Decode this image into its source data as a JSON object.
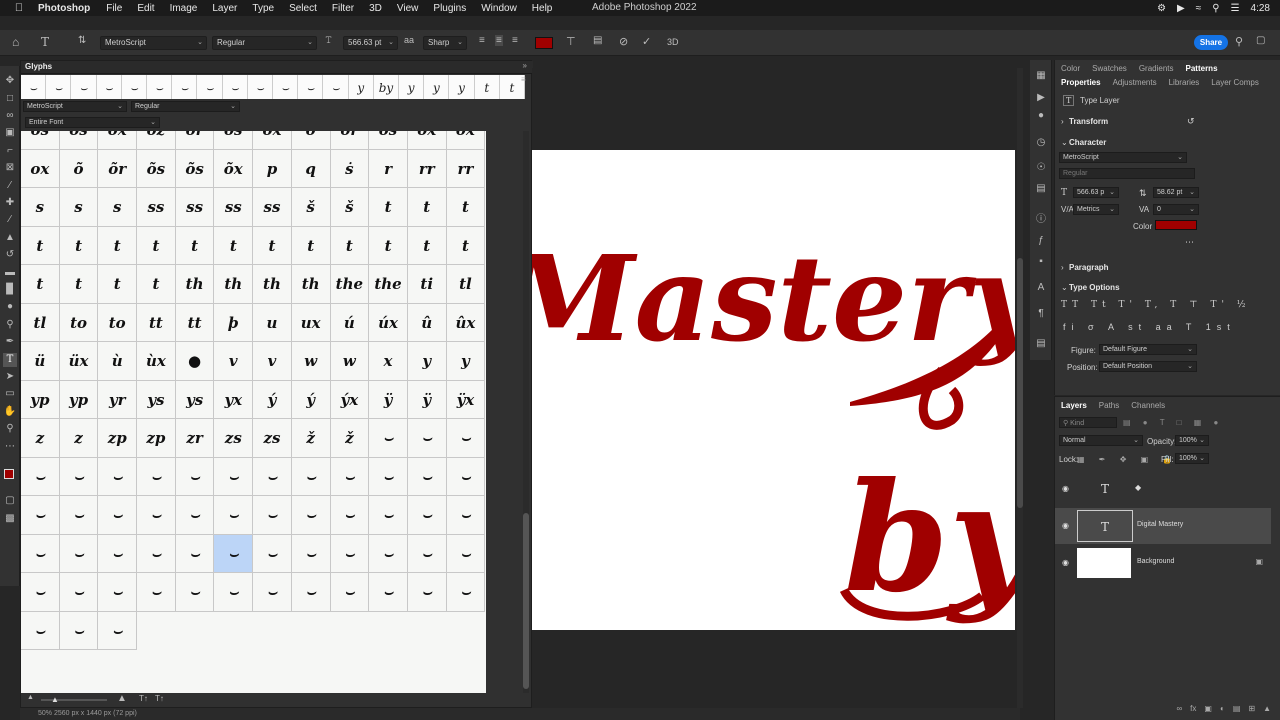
{
  "menubar": {
    "app_name": "Photoshop",
    "items": [
      "File",
      "Edit",
      "Image",
      "Layer",
      "Type",
      "Select",
      "Filter",
      "3D",
      "View",
      "Plugins",
      "Window",
      "Help"
    ],
    "window_title": "Adobe Photoshop 2022",
    "clock": "4:28"
  },
  "options_bar": {
    "font_family": "MetroScript",
    "font_style": "Regular",
    "font_size": "566.63 pt",
    "antialias": "Sharp",
    "text_color": "#a00000",
    "mode_3d": "3D",
    "share_label": "Share"
  },
  "glyphs_panel": {
    "title": "Glyphs",
    "font_family": "MetroScript",
    "font_style": "Regular",
    "show": "Entire Font",
    "recent": [
      "⌣",
      "⌣",
      "⌣",
      "⌣",
      "⌣",
      "⌣",
      "⌣",
      "⌣",
      "⌣",
      "⌣",
      "⌣",
      "⌣",
      "⌣",
      "y",
      "by",
      "y",
      "y",
      "y",
      "t",
      "t"
    ],
    "cells": [
      "os",
      "os",
      "ox",
      "oz",
      "or",
      "os",
      "ox",
      "o",
      "or",
      "os",
      "ox",
      "ox",
      "ox",
      "õ",
      "õr",
      "õs",
      "õs",
      "õx",
      "p",
      "q",
      "ṡ",
      "r",
      "rr",
      "rr",
      "s",
      "s",
      "s",
      "ss",
      "ss",
      "ss",
      "ss",
      "š",
      "š",
      "t",
      "t",
      "t",
      "t",
      "t",
      "t",
      "t",
      "t",
      "t",
      "t",
      "t",
      "t",
      "t",
      "t",
      "t",
      "t",
      "t",
      "t",
      "t",
      "th",
      "th",
      "th",
      "th",
      "the",
      "the",
      "ti",
      "tl",
      "tl",
      "to",
      "to",
      "tt",
      "tt",
      "þ",
      "u",
      "ux",
      "ú",
      "úx",
      "û",
      "ûx",
      "ü",
      "üx",
      "ù",
      "ùx",
      "●",
      "v",
      "v",
      "w",
      "w",
      "x",
      "y",
      "y",
      "yp",
      "yp",
      "yr",
      "ys",
      "ys",
      "yx",
      "ý",
      "ý",
      "ýx",
      "ÿ",
      "ÿ",
      "ÿx",
      "z",
      "z",
      "zp",
      "zp",
      "zr",
      "zs",
      "zs",
      "ž",
      "ž",
      "⌣",
      "⌣",
      "⌣",
      "⌣",
      "⌣",
      "⌣",
      "⌣",
      "⌣",
      "⌣",
      "⌣",
      "⌣",
      "⌣",
      "⌣",
      "⌣",
      "⌣",
      "⌣",
      "⌣",
      "⌣",
      "⌣",
      "⌣",
      "⌣",
      "⌣",
      "⌣",
      "⌣",
      "⌣",
      "⌣",
      "⌣",
      "⌣",
      "⌣",
      "⌣",
      "⌣",
      "⌣",
      "⌣",
      "⌣",
      "⌣",
      "⌣",
      "⌣",
      "⌣",
      "⌣",
      "⌣",
      "⌣",
      "⌣",
      "⌣",
      "⌣",
      "⌣",
      "⌣",
      "⌣",
      "⌣",
      "⌣",
      "⌣",
      "⌣",
      "⌣",
      "⌣",
      "⌣"
    ],
    "selected_index": 137
  },
  "canvas": {
    "line1": "Mastery",
    "line2": "by",
    "text_color": "#a00000"
  },
  "right_panel": {
    "top_tabs": [
      "Color",
      "Swatches",
      "Gradients",
      "Patterns"
    ],
    "active_top_tab": "Patterns",
    "sub_tabs": [
      "Properties",
      "Adjustments",
      "Libraries",
      "Layer Comps"
    ],
    "active_sub_tab": "Properties",
    "layer_kind": "Type Layer",
    "transform_label": "Transform",
    "character_label": "Character",
    "font_family": "MetroScript",
    "font_style": "Regular",
    "font_size": "566.63 p",
    "leading": "58.62 pt",
    "kerning": "Metrics",
    "tracking": "0",
    "color_label": "Color",
    "color_value": "#a00000",
    "paragraph_label": "Paragraph",
    "type_options_label": "Type Options",
    "figure_label": "Figure:",
    "figure_value": "Default Figure",
    "position_label": "Position:",
    "position_value": "Default Position"
  },
  "layers_panel": {
    "tabs": [
      "Layers",
      "Paths",
      "Channels"
    ],
    "active_tab": "Layers",
    "kind_placeholder": "Kind",
    "blend_mode": "Normal",
    "opacity_label": "Opacity:",
    "opacity": "100%",
    "lock_label": "Lock:",
    "fill_label": "Fill:",
    "fill": "100%",
    "layers": [
      {
        "name": "◆",
        "type": "text"
      },
      {
        "name": "Digital Mastery",
        "type": "text"
      },
      {
        "name": "Background",
        "type": "image"
      }
    ],
    "selected_layer": "Digital Mastery"
  },
  "status_bar": {
    "text": "50% 2560 px x 1440 px (72 ppi)"
  }
}
